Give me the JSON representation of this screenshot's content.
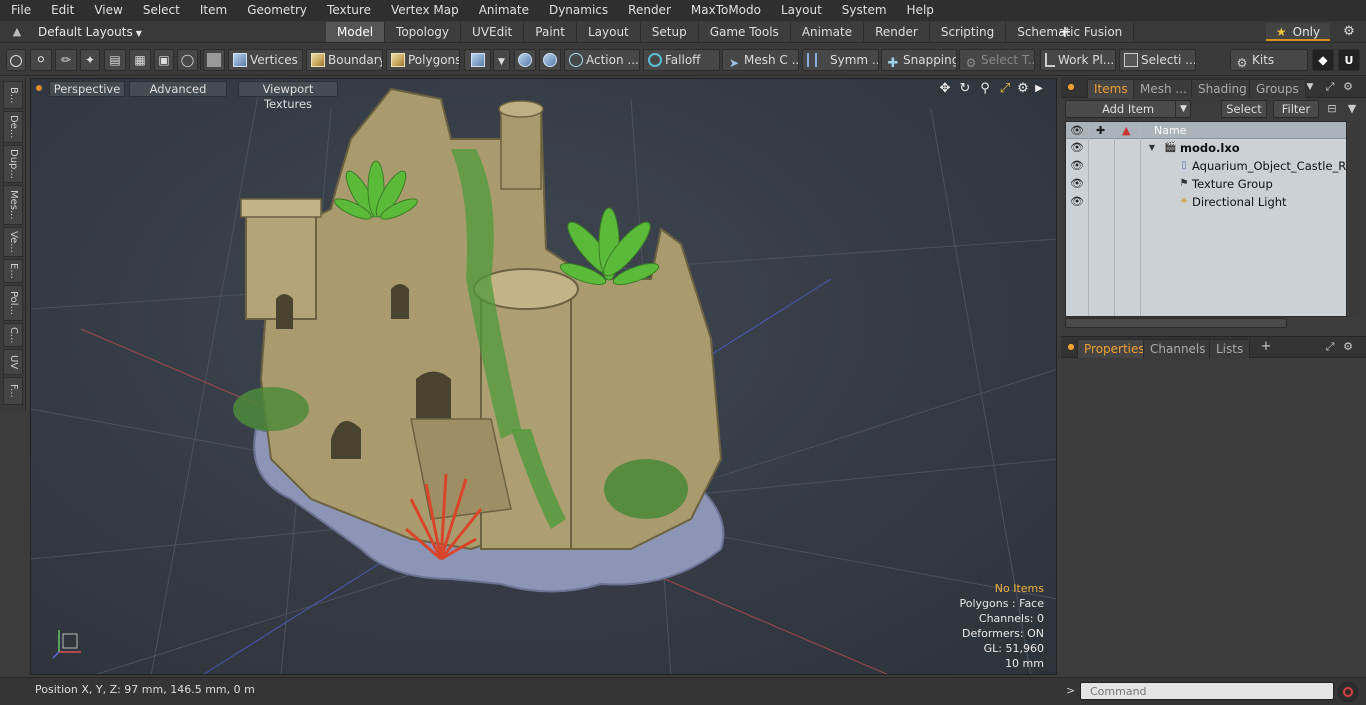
{
  "menu": [
    "File",
    "Edit",
    "View",
    "Select",
    "Item",
    "Geometry",
    "Texture",
    "Vertex Map",
    "Animate",
    "Dynamics",
    "Render",
    "MaxToModo",
    "Layout",
    "System",
    "Help"
  ],
  "layout": {
    "dropdown_label": "Default Layouts",
    "tabs": [
      "Model",
      "Topology",
      "UVEdit",
      "Paint",
      "Layout",
      "Setup",
      "Game Tools",
      "Animate",
      "Render",
      "Scripting",
      "Schematic Fusion"
    ],
    "active_tab": "Model",
    "add_tab": "+",
    "only_label": "Only"
  },
  "toolbar": {
    "vertices": "Vertices",
    "boundary": "Boundary",
    "polygons": "Polygons",
    "action": "Action ...",
    "falloff": "Falloff",
    "mesh_c": "Mesh C ...",
    "symm": "Symm ...",
    "snapping": "Snapping",
    "select_t": "Select T...",
    "work_pl": "Work Pl...",
    "selecti": "Selecti ...",
    "kits": "Kits"
  },
  "left_strip": [
    "B...",
    "De...",
    "Dup...",
    "Mes...",
    "Ve...",
    "E...",
    "Pol...",
    "C...",
    "UV",
    "F..."
  ],
  "viewport": {
    "perspective": "Perspective",
    "advanced": "Advanced",
    "viewport_textures": "Viewport Textures",
    "info": {
      "no_items": "No Items",
      "polygons": "Polygons : Face",
      "channels": "Channels: 0",
      "deformers": "Deformers: ON",
      "gl": "GL: 51,960",
      "scale": "10 mm"
    }
  },
  "items_panel": {
    "tabs": [
      "Items",
      "Mesh ...",
      "Shading",
      "Groups"
    ],
    "active_tab": "Items",
    "add_item": "Add Item",
    "select": "Select",
    "filter": "Filter",
    "column_name": "Name",
    "tree": [
      {
        "label": "modo.lxo",
        "icon": "scene-icon",
        "bold": true
      },
      {
        "label": "Aquarium_Object_Castle_Rui ...",
        "icon": "mesh-icon"
      },
      {
        "label": "Texture Group",
        "icon": "texture-group-icon"
      },
      {
        "label": "Directional Light",
        "icon": "light-icon"
      }
    ]
  },
  "props_panel": {
    "tabs": [
      "Properties",
      "Channels",
      "Lists"
    ],
    "active_tab": "Properties",
    "add": "+"
  },
  "status": {
    "position": "Position X, Y, Z:  97 mm, 146.5 mm, 0 m",
    "command_placeholder": "Command"
  },
  "colors": {
    "accent": "#f0a030",
    "active_tab_bg": "#555555",
    "viewport_bg": "#343b44"
  }
}
